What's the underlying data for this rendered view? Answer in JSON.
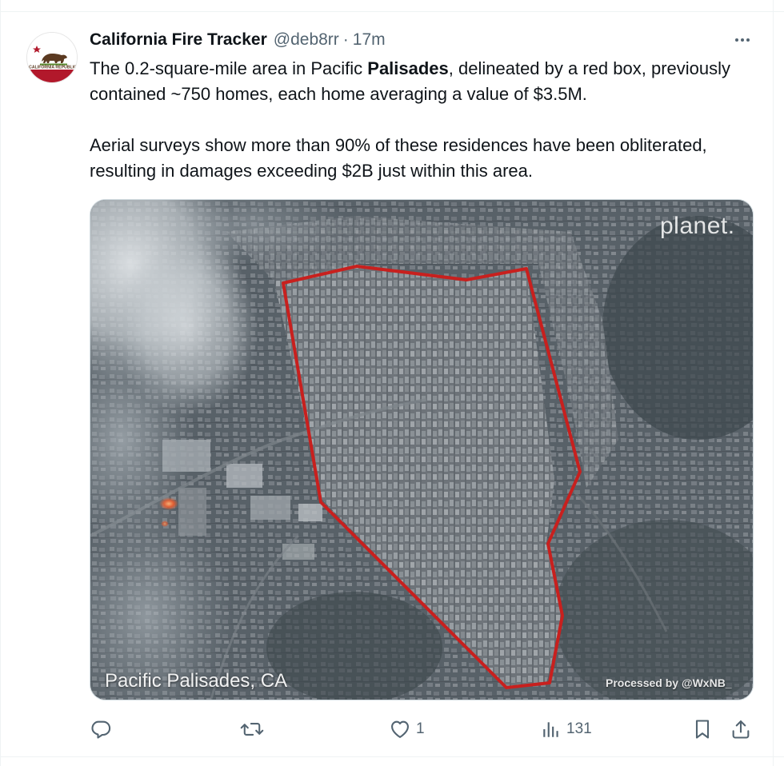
{
  "tweet": {
    "display_name": "California Fire Tracker",
    "handle": "@deb8rr",
    "separator": "·",
    "time": "17m",
    "avatar_text": "CALIFORNIA REPUBLIC",
    "text_p1_before": "The 0.2-square-mile area in Pacific ",
    "text_p1_bold": "Palisades",
    "text_p1_after": ", delineated by a red box, previously contained ~750 homes, each home averaging a value of $3.5M.",
    "text_p2": "Aerial surveys show more than 90% of these residences have been obliterated, resulting in damages exceeding $2B just within this area."
  },
  "media": {
    "logo_text": "planet.",
    "location_label": "Pacific Palisades, CA",
    "processed_label": "Processed by @WxNB_",
    "outline_color": "#c8201e"
  },
  "actions": {
    "reply_count": "",
    "retweet_count": "",
    "like_count": "1",
    "views_count": "131"
  },
  "icons": {
    "more": "more-icon",
    "reply": "reply-icon",
    "retweet": "retweet-icon",
    "like": "heart-icon",
    "views": "views-icon",
    "bookmark": "bookmark-icon",
    "share": "share-icon"
  },
  "colors": {
    "text_primary": "#0f1419",
    "text_secondary": "#536471",
    "border": "#cfd9de"
  }
}
